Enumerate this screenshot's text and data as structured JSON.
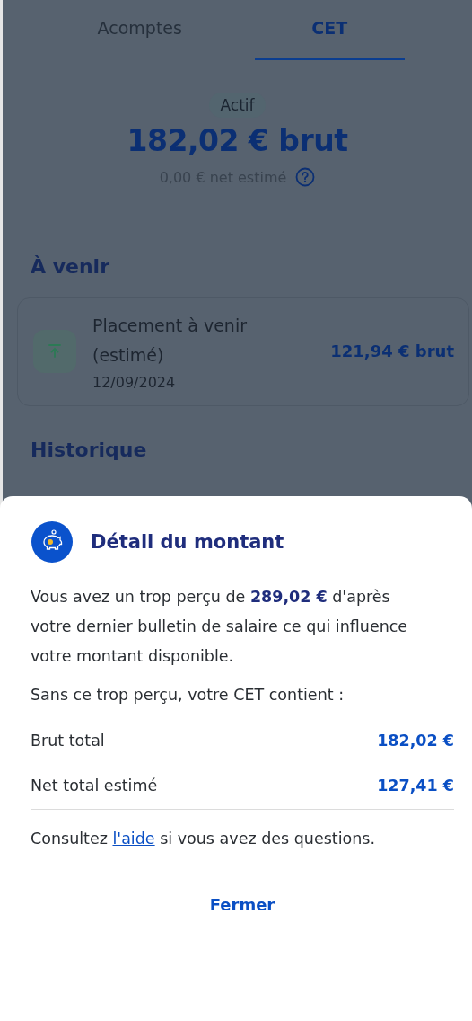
{
  "tabs": [
    {
      "label": "Acomptes",
      "selected": false
    },
    {
      "label": "CET",
      "selected": true
    }
  ],
  "summary": {
    "status": "Actif",
    "amount": "182,02 € brut",
    "net": "0,00 € net estimé"
  },
  "upcoming": {
    "title": "À venir",
    "items": [
      {
        "label": "Placement à venir (estimé)",
        "date": "12/09/2024",
        "amount": "121,94 € brut"
      }
    ]
  },
  "history": {
    "title": "Historique"
  },
  "sheet": {
    "title": "Détail du montant",
    "message": "Vous avez un trop perçu de **289,02 €** d'après votre dernier bulletin de salaire ce qui influence votre montant disponible.",
    "intro": "Sans ce trop perçu, votre CET contient :",
    "rows": [
      {
        "label": "Brut total",
        "value": "182,02 €"
      },
      {
        "label": "Net total estimé",
        "value": "127,41 €"
      }
    ],
    "help_before": "Consultez",
    "help_link": "l'aide",
    "help_after": "si vous avez des questions.",
    "close": "Fermer"
  }
}
